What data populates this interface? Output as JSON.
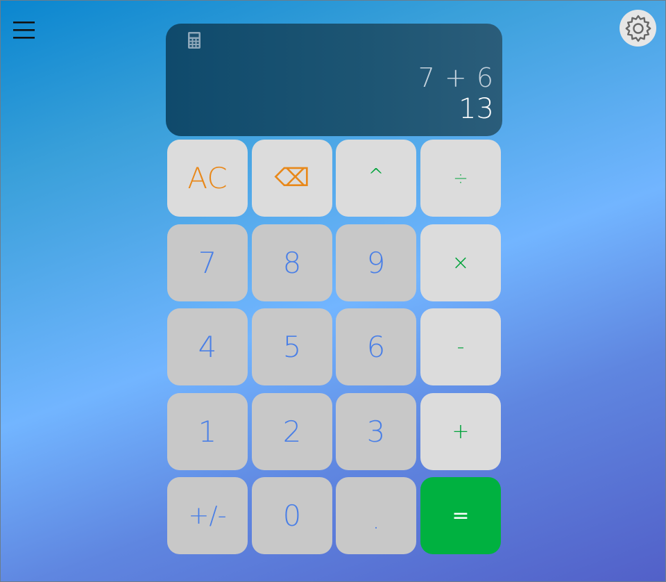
{
  "menu": {
    "icon": "hamburger-menu-icon"
  },
  "settings": {
    "icon": "gear-icon"
  },
  "display": {
    "icon": "calculator-icon",
    "expression": "7 + 6",
    "result": "13"
  },
  "keys": [
    {
      "label": "AC",
      "kind": "fn",
      "color": "#e8881a"
    },
    {
      "label": "⌫",
      "kind": "fn",
      "color": "#e8881a"
    },
    {
      "label": "^",
      "kind": "op",
      "color": "#00a33a"
    },
    {
      "label": "÷",
      "kind": "op",
      "color": "#00a33a"
    },
    {
      "label": "7",
      "kind": "num",
      "color": "#4a7fe6"
    },
    {
      "label": "8",
      "kind": "num",
      "color": "#4a7fe6"
    },
    {
      "label": "9",
      "kind": "num",
      "color": "#4a7fe6"
    },
    {
      "label": "×",
      "kind": "op",
      "color": "#00a33a"
    },
    {
      "label": "4",
      "kind": "num",
      "color": "#4a7fe6"
    },
    {
      "label": "5",
      "kind": "num",
      "color": "#4a7fe6"
    },
    {
      "label": "6",
      "kind": "num",
      "color": "#4a7fe6"
    },
    {
      "label": "-",
      "kind": "op",
      "color": "#00a33a"
    },
    {
      "label": "1",
      "kind": "num",
      "color": "#4a7fe6"
    },
    {
      "label": "2",
      "kind": "num",
      "color": "#4a7fe6"
    },
    {
      "label": "3",
      "kind": "num",
      "color": "#4a7fe6"
    },
    {
      "label": "+",
      "kind": "op",
      "color": "#00a33a"
    },
    {
      "label": "+/-",
      "kind": "num",
      "color": "#4a7fe6"
    },
    {
      "label": "0",
      "kind": "num",
      "color": "#4a7fe6"
    },
    {
      "label": ".",
      "kind": "num",
      "color": "#4a7fe6"
    },
    {
      "label": "=",
      "kind": "eq",
      "color": "#ffffff"
    }
  ],
  "colors": {
    "display_bg": "#1a4f6e",
    "equals_bg": "#00b140",
    "accent_orange": "#e8881a",
    "accent_green": "#00a33a",
    "digit_blue": "#4a7fe6"
  }
}
